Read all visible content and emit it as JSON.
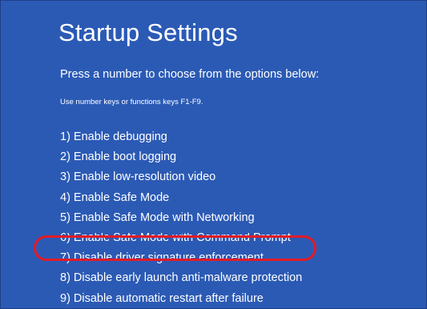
{
  "screen": {
    "title": "Startup Settings",
    "subtitle": "Press a number to choose from the options below:",
    "hint": "Use number keys or functions keys F1-F9."
  },
  "options": [
    {
      "label": "1) Enable debugging"
    },
    {
      "label": "2) Enable boot logging"
    },
    {
      "label": "3) Enable low-resolution video"
    },
    {
      "label": "4) Enable Safe Mode"
    },
    {
      "label": "5) Enable Safe Mode with Networking"
    },
    {
      "label": "6) Enable Safe Mode with Command Prompt"
    },
    {
      "label": "7) Disable driver signature enforcement"
    },
    {
      "label": "8) Disable early launch anti-malware protection"
    },
    {
      "label": "9) Disable automatic restart after failure"
    }
  ],
  "highlighted_option_index": 7,
  "colors": {
    "background": "#2b5ab5",
    "text": "#ffffff",
    "highlight_outline": "#e21b25"
  }
}
